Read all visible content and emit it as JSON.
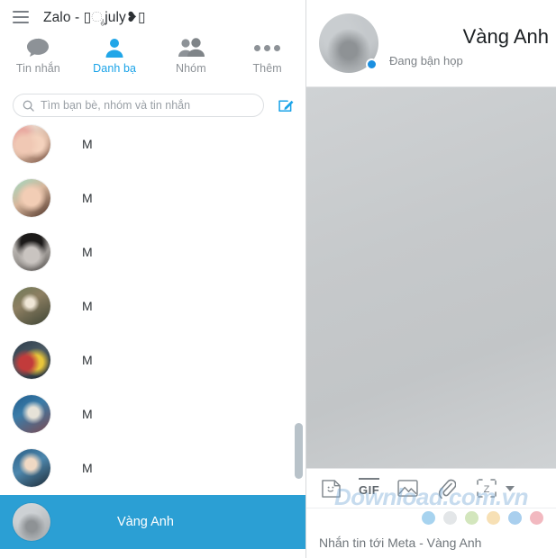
{
  "window": {
    "title": "Zalo - ▯ೖjuly❥▯",
    "menu_icon": "hamburger-icon"
  },
  "nav_tabs": [
    {
      "label": "Tin nhắn",
      "icon": "chat-bubble-icon",
      "active": false
    },
    {
      "label": "Danh bạ",
      "icon": "person-icon",
      "active": true
    },
    {
      "label": "Nhóm",
      "icon": "group-icon",
      "active": false
    },
    {
      "label": "Thêm",
      "icon": "more-dots-icon",
      "active": false
    }
  ],
  "search": {
    "placeholder": "Tìm bạn bè, nhóm và tin nhắn",
    "value": "",
    "icon": "search-icon",
    "compose_icon": "compose-edit-icon"
  },
  "contacts": [
    {
      "name": "M"
    },
    {
      "name": "M"
    },
    {
      "name": "M"
    },
    {
      "name": "M"
    },
    {
      "name": "M"
    },
    {
      "name": "M"
    },
    {
      "name": "M"
    },
    {
      "name": "Vàng Anh"
    }
  ],
  "chat": {
    "title": "Vàng Anh",
    "status": "Đang bận họp",
    "presence": "online",
    "avatar": "contact-avatar"
  },
  "toolbar": {
    "sticker_label": "sticker-icon",
    "gif_label": "GIF",
    "image_label": "image-icon",
    "attach_label": "paperclip-icon",
    "capture_label": "Z",
    "caret_label": "chevron-down-icon"
  },
  "colors": {
    "accent": "#1aa3e8",
    "selected_row": "#2b9fd4",
    "online": "#1b8fe0",
    "dots": [
      "#a7d3ef",
      "#e3e6e8",
      "#d3e6bd",
      "#f7e0b5",
      "#a9cfee",
      "#f2b9c0"
    ]
  },
  "composer": {
    "placeholder": "Nhắn tin tới Meta - Vàng Anh",
    "value": ""
  },
  "watermark": {
    "text": "Download.com.vn"
  }
}
